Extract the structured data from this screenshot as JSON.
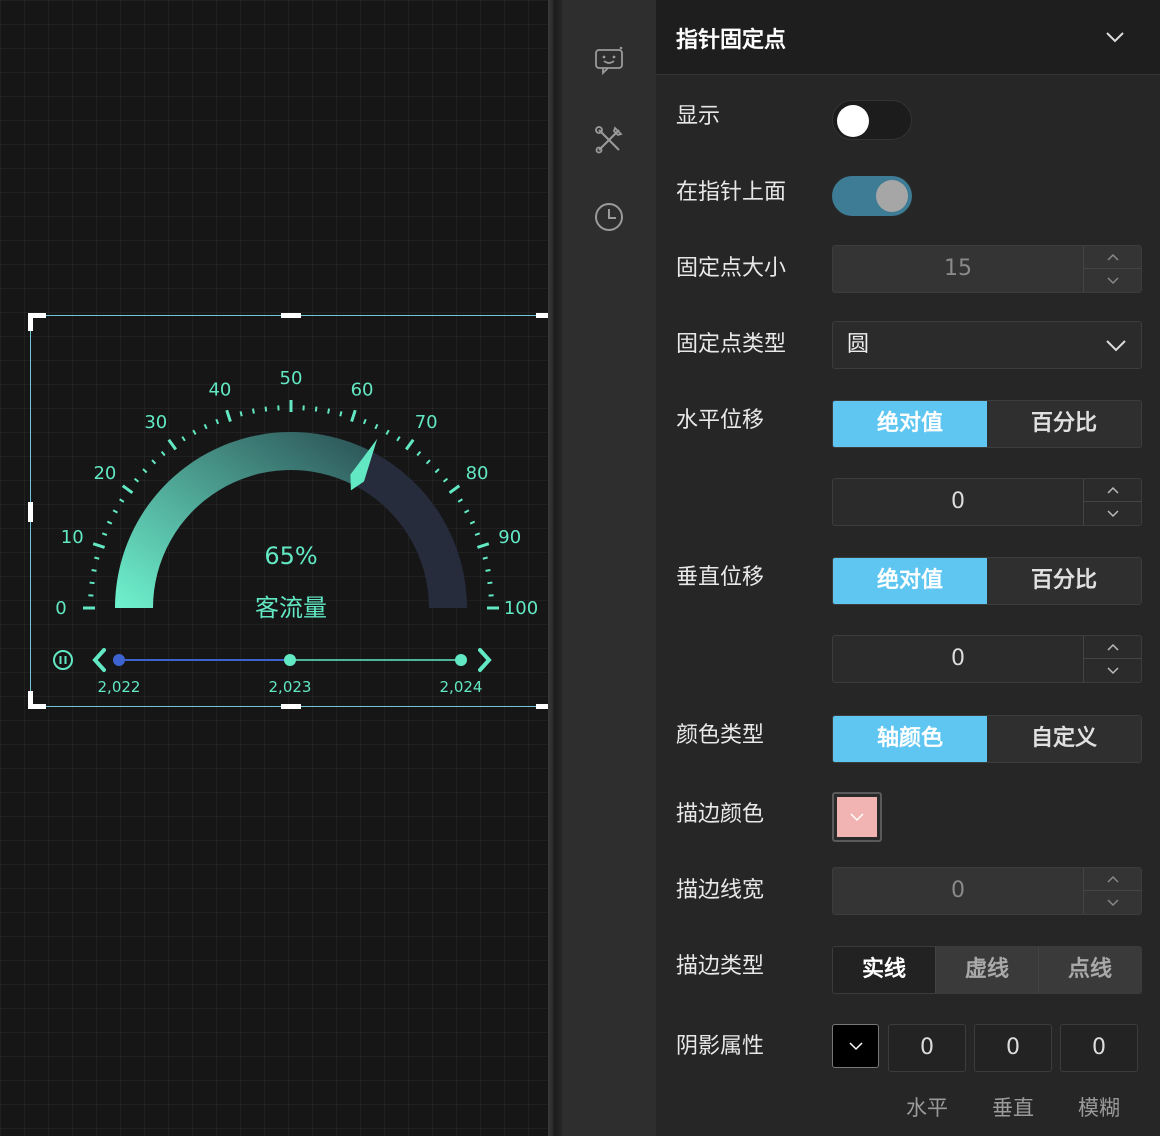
{
  "gauge": {
    "value_label": "65%",
    "name": "客流量",
    "value": 65,
    "ticks": [
      "0",
      "10",
      "20",
      "30",
      "40",
      "50",
      "60",
      "70",
      "80",
      "90",
      "100"
    ],
    "timeline": [
      "2,022",
      "2,023",
      "2,024"
    ],
    "colors": {
      "arc_start": "#6ff3cf",
      "arc_end": "#2a4f54",
      "track": "#262c3c",
      "accent": "#62e8c3",
      "timeline_line": "#3d63d0"
    }
  },
  "rail": {
    "icons": [
      "chat-bot-icon",
      "tools-icon",
      "clock-icon"
    ]
  },
  "panel": {
    "title": "指针固定点",
    "show": {
      "label": "显示",
      "on": false
    },
    "on_top": {
      "label": "在指针上面",
      "on": true
    },
    "point_size": {
      "label": "固定点大小",
      "value": "15"
    },
    "point_type": {
      "label": "固定点类型",
      "value": "圆"
    },
    "h_offset": {
      "label": "水平位移",
      "opt_a": "绝对值",
      "opt_b": "百分比",
      "value": "0"
    },
    "v_offset": {
      "label": "垂直位移",
      "opt_a": "绝对值",
      "opt_b": "百分比",
      "value": "0"
    },
    "color_type": {
      "label": "颜色类型",
      "opt_a": "轴颜色",
      "opt_b": "自定义"
    },
    "stroke_color": {
      "label": "描边颜色",
      "color": "#f2b3b3"
    },
    "stroke_width": {
      "label": "描边线宽",
      "value": "0"
    },
    "stroke_type": {
      "label": "描边类型",
      "opt_a": "实线",
      "opt_b": "虚线",
      "opt_c": "点线"
    },
    "shadow": {
      "label": "阴影属性",
      "h": "0",
      "v": "0",
      "blur": "0",
      "h_label": "水平",
      "v_label": "垂直",
      "blur_label": "模糊"
    }
  }
}
